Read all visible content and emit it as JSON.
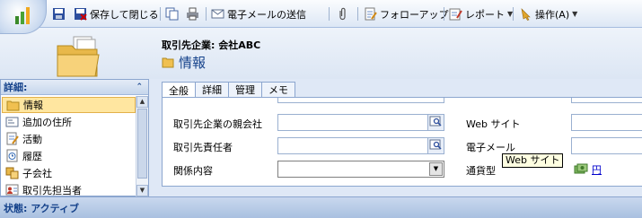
{
  "toolbar": {
    "save_label": "",
    "save_close_label": "保存して閉じる",
    "send_email_label": "電子メールの送信",
    "follow_up_label": "フォローアップ",
    "reports_label": "レポート",
    "actions_label": "操作(A)"
  },
  "header": {
    "entity_title": "取引先企業: 会社ABC",
    "page_title": "情報"
  },
  "nav": {
    "section_title": "詳細:",
    "items": [
      {
        "label": "情報",
        "icon": "info-form-icon",
        "selected": true
      },
      {
        "label": "追加の住所",
        "icon": "address-icon"
      },
      {
        "label": "活動",
        "icon": "activities-icon"
      },
      {
        "label": "履歴",
        "icon": "history-icon"
      },
      {
        "label": "子会社",
        "icon": "sub-accounts-icon"
      },
      {
        "label": "取引先担当者",
        "icon": "contacts-icon"
      }
    ]
  },
  "tabs": [
    "全般",
    "詳細",
    "管理",
    "メモ"
  ],
  "form": {
    "left_fields": [
      {
        "label": "取引先企業の親会社",
        "value": "",
        "type": "lookup"
      },
      {
        "label": "取引先責任者",
        "value": "",
        "type": "lookup"
      },
      {
        "label": "関係内容",
        "value": "",
        "type": "select"
      }
    ],
    "right_fields": [
      {
        "label": "Web サイト",
        "value": ""
      },
      {
        "label": "電子メール",
        "value": ""
      },
      {
        "label": "通貨型",
        "value": "円"
      }
    ],
    "currency_value": "円"
  },
  "tooltip": "Web サイト",
  "status": "状態: アクティブ",
  "colors": {
    "accent": "#15428b",
    "selected": "#ffe6a0",
    "border": "#8ca6cf"
  }
}
